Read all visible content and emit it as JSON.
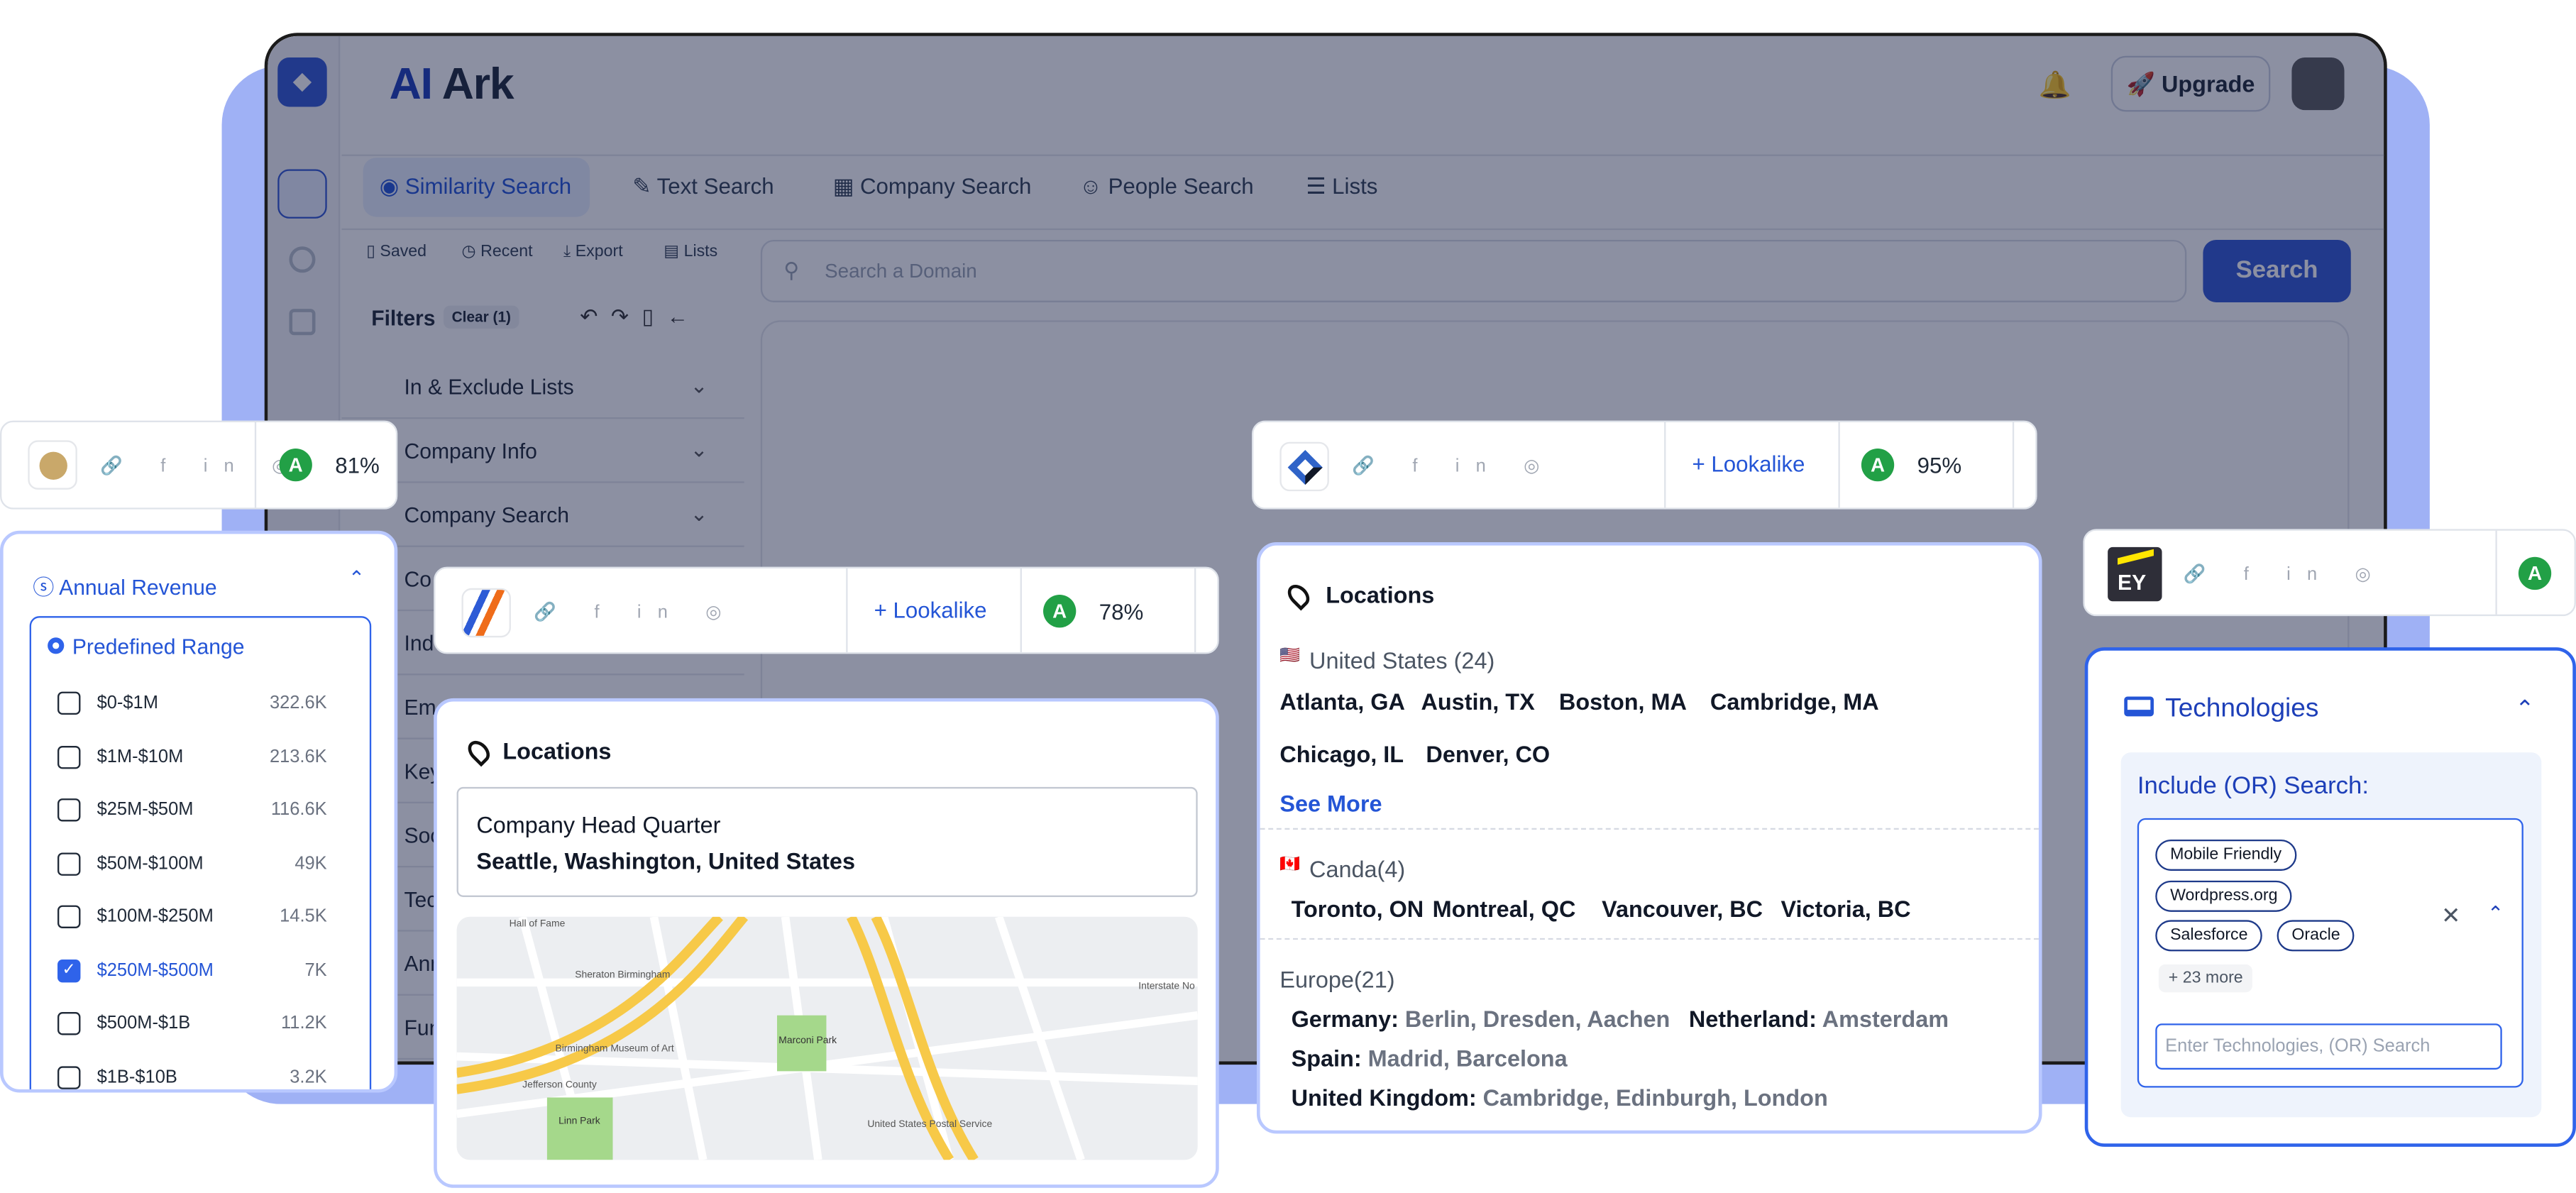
{
  "app": {
    "brand_ai": "AI",
    "brand_rest": " Ark",
    "upgrade": "🚀 Upgrade",
    "tabs": [
      "Similarity Search",
      "Text Search",
      "Company Search",
      "People Search",
      "Lists"
    ],
    "sub_actions": [
      "Saved",
      "Recent",
      "Export",
      "Lists"
    ],
    "filters_title": "Filters",
    "clear_label": "Clear (1)",
    "filter_rows": [
      "In & Exclude Lists",
      "Company Info",
      "Company Search",
      "Co",
      "Ind",
      "Em",
      "Key",
      "Soc",
      "Tec",
      "Ann",
      "Fun"
    ],
    "search_placeholder": "Search a Domain",
    "search_button": "Search"
  },
  "card_81": {
    "pct": "81%",
    "grade": "A"
  },
  "card_78": {
    "lookalike": "+ Lookalike",
    "grade": "A",
    "pct": "78%"
  },
  "card_95": {
    "lookalike": "+ Lookalike",
    "grade": "A",
    "pct": "95%"
  },
  "card_ey": {
    "logo": "EY",
    "grade": "A"
  },
  "revenue": {
    "title": "Annual Revenue",
    "mode": "Predefined Range",
    "items": [
      {
        "label": "$0-$1M",
        "count": "322.6K",
        "checked": false
      },
      {
        "label": "$1M-$10M",
        "count": "213.6K",
        "checked": false
      },
      {
        "label": "$25M-$50M",
        "count": "116.6K",
        "checked": false
      },
      {
        "label": "$50M-$100M",
        "count": "49K",
        "checked": false
      },
      {
        "label": "$100M-$250M",
        "count": "14.5K",
        "checked": false
      },
      {
        "label": "$250M-$500M",
        "count": "7K",
        "checked": true
      },
      {
        "label": "$500M-$1B",
        "count": "11.2K",
        "checked": false
      },
      {
        "label": "$1B-$10B",
        "count": "3.2K",
        "checked": false
      }
    ]
  },
  "hq": {
    "title": "Locations",
    "label": "Company Head Quarter",
    "value": "Seattle, Washington, United States",
    "map_labels": [
      "Hall of Fame",
      "Sheraton Birmingham",
      "Birmingham Museum of Art",
      "Jefferson County",
      "Linn Park",
      "Marconi Park",
      "United States Postal Service",
      "Interstate No"
    ]
  },
  "locations": {
    "title": "Locations",
    "us_flag": "🇺🇸",
    "us": "United States (24)",
    "us_cities": [
      "Atlanta, GA",
      "Austin, TX",
      "Boston, MA",
      "Cambridge, MA",
      "Chicago, IL",
      "Denver, CO"
    ],
    "see_more": "See More",
    "ca_flag": "🇨🇦",
    "ca": "Canda(4)",
    "ca_cities": [
      "Toronto, ON",
      "Montreal, QC",
      "Vancouver, BC",
      "Victoria, BC"
    ],
    "eu": "Europe(21)",
    "eu_rows": [
      {
        "country": "Germany:",
        "cities": "Berlin, Dresden, Aachen"
      },
      {
        "country": "Netherland:",
        "cities": "Amsterdam"
      },
      {
        "country": "Spain:",
        "cities": "Madrid, Barcelona"
      },
      {
        "country": "United Kingdom:",
        "cities": "Cambridge, Edinburgh, London"
      }
    ]
  },
  "tech": {
    "title": "Technologies",
    "include_label": "Include (OR) Search:",
    "tags": [
      "Mobile Friendly",
      "Wordpress.org",
      "Salesforce",
      "Oracle"
    ],
    "more": "+ 23 more",
    "placeholder": "Enter Technologies, (OR) Search"
  },
  "colors": {
    "accent": "#2455d6",
    "brand": "#3358d4",
    "grade": "#22a046",
    "bg_panel": "#9fb1f5"
  }
}
